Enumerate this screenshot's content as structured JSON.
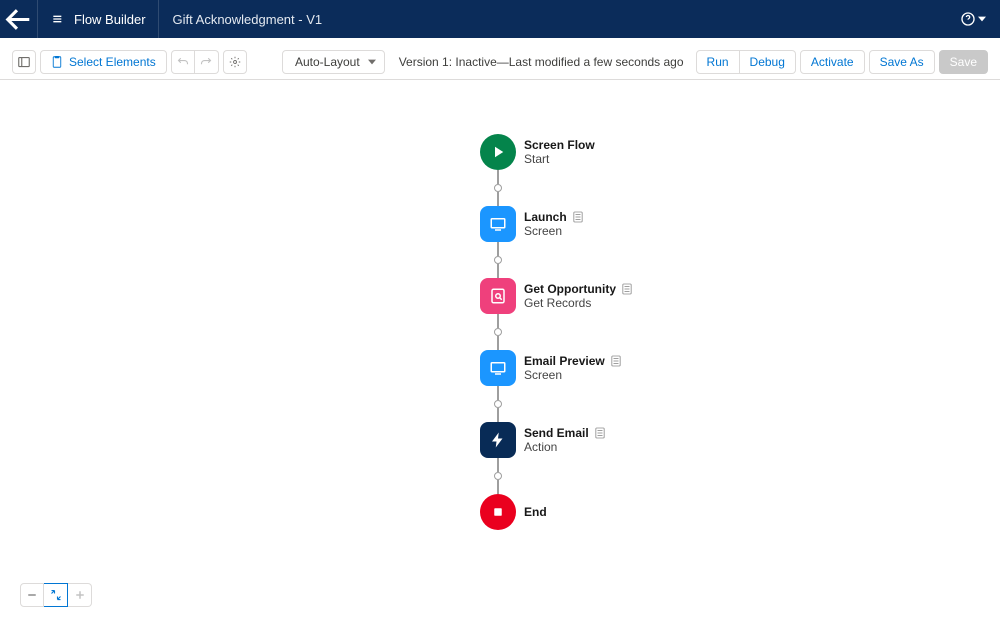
{
  "header": {
    "app_name": "Flow Builder",
    "flow_name": "Gift Acknowledgment - V1"
  },
  "toolbar": {
    "select_elements": "Select Elements",
    "layout_label": "Auto-Layout",
    "status": "Version 1: Inactive—Last modified a few seconds ago",
    "run": "Run",
    "debug": "Debug",
    "activate": "Activate",
    "save_as": "Save As",
    "save": "Save"
  },
  "nodes": {
    "start": {
      "title": "Screen Flow",
      "sub": "Start"
    },
    "launch": {
      "title": "Launch",
      "sub": "Screen"
    },
    "get_opportunity": {
      "title": "Get Opportunity",
      "sub": "Get Records"
    },
    "email_preview": {
      "title": "Email Preview",
      "sub": "Screen"
    },
    "send_email": {
      "title": "Send Email",
      "sub": "Action"
    },
    "end": {
      "title": "End"
    }
  }
}
